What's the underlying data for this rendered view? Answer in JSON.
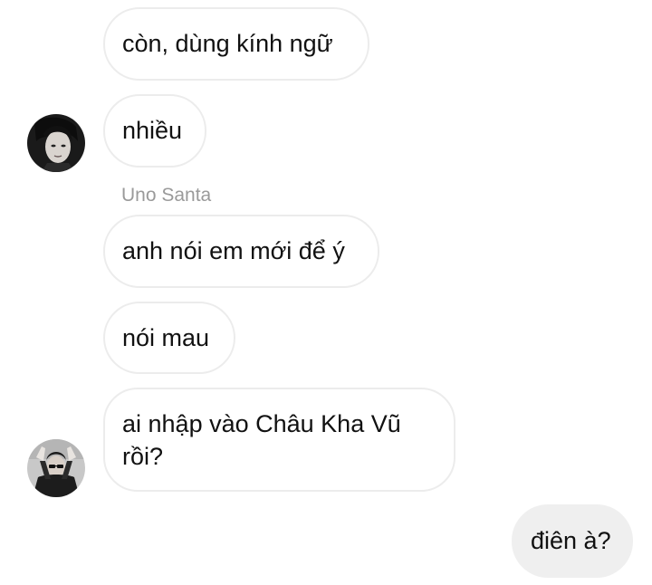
{
  "messages": [
    {
      "text": "còn, dùng kính ngữ"
    },
    {
      "text": "nhiều"
    },
    {
      "sender": "Uno Santa"
    },
    {
      "text": "anh nói em mới để ý"
    },
    {
      "text": "nói mau"
    },
    {
      "text": "ai nhập vào Châu Kha Vũ rồi?"
    },
    {
      "text": "điên à?"
    }
  ],
  "avatars": [
    "avatar-dark-portrait",
    "avatar-hands-up-portrait"
  ]
}
